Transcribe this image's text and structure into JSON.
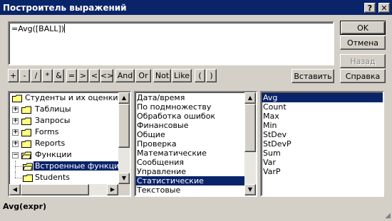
{
  "window": {
    "title": "Построитель выражений",
    "help_label": "?",
    "close_label": "✕"
  },
  "expression": {
    "value": "=Avg([BALL])"
  },
  "buttons": {
    "ok": "OK",
    "cancel": "Отмена",
    "undo": "Назад",
    "paste": "Вставить",
    "help": "Справка"
  },
  "operators": [
    "+",
    "-",
    "/",
    "*",
    "&",
    "=",
    ">",
    "<",
    "<>",
    "And",
    "Or",
    "Not",
    "Like",
    "(",
    ")"
  ],
  "tree": {
    "items": [
      {
        "label": "Студенты и их оценки",
        "icon": "folder-icon",
        "expander": ""
      },
      {
        "label": "Таблицы",
        "icon": "folder-icon",
        "expander": "+"
      },
      {
        "label": "Запросы",
        "icon": "folder-icon",
        "expander": "+"
      },
      {
        "label": "Forms",
        "icon": "folder-icon",
        "expander": "+"
      },
      {
        "label": "Reports",
        "icon": "folder-icon",
        "expander": "+"
      },
      {
        "label": "Функции",
        "icon": "folder-open-icon",
        "expander": "−"
      },
      {
        "label": "Встроенные функции",
        "icon": "folder-open-icon",
        "expander": ""
      },
      {
        "label": "Students",
        "icon": "folder-icon",
        "expander": ""
      }
    ],
    "selected_index": 6
  },
  "categories": {
    "items": [
      "Дата/время",
      "По подмножеству",
      "Обработка ошибок",
      "Финансовые",
      "Общие",
      "Проверка",
      "Математические",
      "Сообщения",
      "Управление",
      "Статистические",
      "Текстовые"
    ],
    "selected_index": 9
  },
  "functions": {
    "items": [
      "Avg",
      "Count",
      "Max",
      "Min",
      "StDev",
      "StDevP",
      "Sum",
      "Var",
      "VarP"
    ],
    "selected_index": 0
  },
  "status": {
    "syntax": "Avg(expr)"
  },
  "colors": {
    "title_bar": "#0a246a",
    "face": "#d4d0c8",
    "selection": "#0a246a"
  }
}
